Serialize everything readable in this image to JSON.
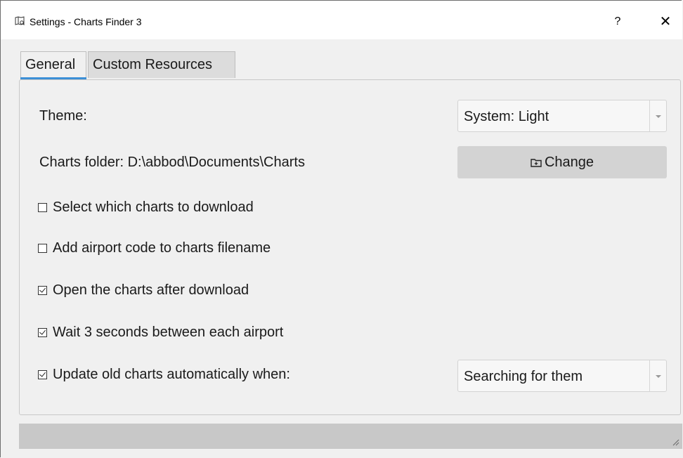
{
  "window": {
    "title": "Settings - Charts Finder 3",
    "help_label": "?",
    "close_label": "✕",
    "icon": "charts-app-icon"
  },
  "tabs": [
    {
      "label": "General",
      "active": true
    },
    {
      "label": "Custom Resources",
      "active": false
    }
  ],
  "general": {
    "theme_label": "Theme:",
    "theme_value": "System: Light",
    "charts_folder_label": "Charts folder: D:\\abbod\\Documents\\Charts",
    "change_button_label": "Change",
    "change_button_icon": "folder-icon",
    "checkboxes": [
      {
        "label": "Select which charts to download",
        "checked": false
      },
      {
        "label": "Add airport code to charts filename",
        "checked": false
      },
      {
        "label": "Open the charts after download",
        "checked": true
      },
      {
        "label": "Wait 3 seconds between each airport",
        "checked": true
      },
      {
        "label": "Update old charts automatically when:",
        "checked": true
      }
    ],
    "update_when_value": "Searching for them"
  },
  "colors": {
    "active_tab_indicator": "#3c8fd6",
    "button_bg": "#d3d3d3",
    "window_bg": "#f0f0f0"
  }
}
